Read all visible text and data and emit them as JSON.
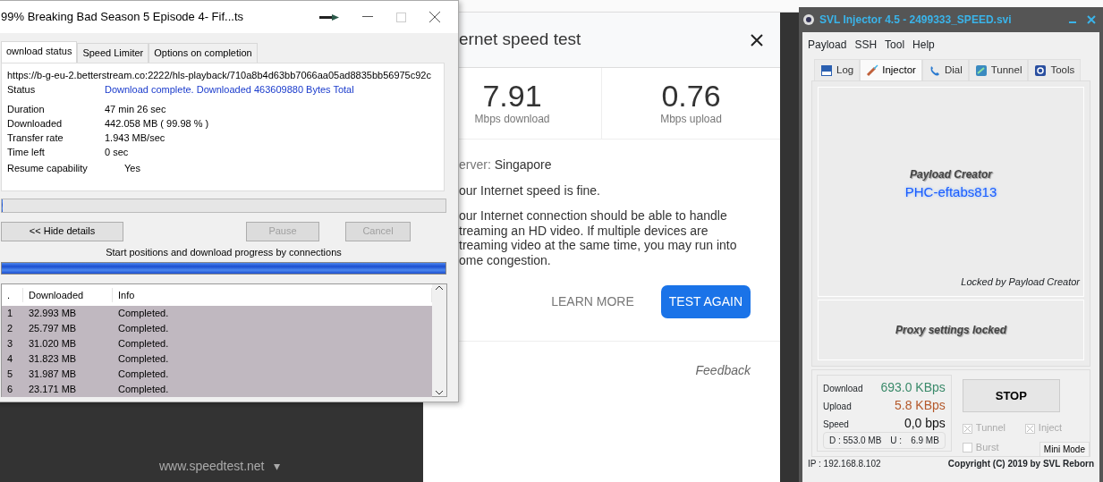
{
  "download_dialog": {
    "title": "99% Breaking Bad Season 5 Episode 4- Fif...ts",
    "tabs": [
      {
        "label": "ownload status",
        "selected": true
      },
      {
        "label": "Speed Limiter",
        "selected": false
      },
      {
        "label": "Options on completion",
        "selected": false
      }
    ],
    "url": "https://b-g-eu-2.betterstream.co:2222/hls-playback/710a8b4d63bb7066aa05ad8835bb56975c92c",
    "status": {
      "label": "Status",
      "value": "Download complete. Downloaded 463609880 Bytes Total"
    },
    "details": [
      {
        "label": "Duration",
        "value": "47 min 26 sec"
      },
      {
        "label": "Downloaded",
        "value": "442.058  MB  ( 99.98 % )"
      },
      {
        "label": "Transfer rate",
        "value": "1.943  MB/sec"
      },
      {
        "label": "Time left",
        "value": "0 sec"
      }
    ],
    "resume": {
      "label": "Resume capability",
      "value": "Yes"
    },
    "progress": {
      "level": 0
    },
    "buttons": [
      {
        "label": "<< Hide details",
        "disabled": false
      },
      {
        "label": "Pause",
        "disabled": true
      },
      {
        "label": "Cancel",
        "disabled": true
      }
    ],
    "connections_caption": "Start positions and download progress by connections",
    "connections_progress": {
      "level": 1
    },
    "table": {
      "columns": [
        ".",
        "Downloaded",
        "Info"
      ],
      "rows": [
        {
          "column_1": "1",
          "downloaded": "32.993  MB",
          "info": "Completed."
        },
        {
          "column_1": "2",
          "downloaded": "25.797  MB",
          "info": "Completed."
        },
        {
          "column_1": "3",
          "downloaded": "31.020  MB",
          "info": "Completed."
        },
        {
          "column_1": "4",
          "downloaded": "31.823  MB",
          "info": "Completed."
        },
        {
          "column_1": "5",
          "downloaded": "31.987  MB",
          "info": "Completed."
        },
        {
          "column_1": "6",
          "downloaded": "23.171  MB",
          "info": "Completed."
        }
      ]
    }
  },
  "background_page": {
    "footer_link": "www.speedtest.net",
    "footer_caret": "▾"
  },
  "speed_test": {
    "title": "ernet speed test",
    "results": [
      {
        "value": "7.91",
        "unit": "Mbps download"
      },
      {
        "value": "0.76",
        "unit": "Mbps upload"
      }
    ],
    "server_label": "erver:",
    "server_value": "Singapore",
    "verdict": "our Internet speed is fine.",
    "description": "our Internet connection should be able to handle treaming an HD video. If multiple devices are treaming video at the same time, you may run into ome congestion.",
    "learn_more": "LEARN MORE",
    "test_again": "TEST AGAIN",
    "feedback": "Feedback"
  },
  "injector": {
    "title": "SVL Injector 4.5 - 2499333_SPEED.svi",
    "menu": [
      "Payload",
      "SSH",
      "Tool",
      "Help"
    ],
    "tabs": [
      {
        "label": "Log",
        "selected": false,
        "kind": "log"
      },
      {
        "label": "Injector",
        "selected": true,
        "kind": "injector"
      },
      {
        "label": "Dial",
        "selected": false,
        "kind": "dial"
      },
      {
        "label": "Tunnel",
        "selected": false,
        "kind": "tunnel"
      },
      {
        "label": "Tools",
        "selected": false,
        "kind": "tools"
      }
    ],
    "payload_caption": "Payload Creator",
    "payload_name": "PHC-eftabs813",
    "locked_by": "Locked by Payload Creator",
    "proxy_locked": "Proxy settings locked",
    "stats": [
      {
        "label": "Download",
        "value": "693.0 KBps",
        "color": "#3a8a6a"
      },
      {
        "label": "Upload",
        "value": "5.8 KBps",
        "color": "#b4582a"
      },
      {
        "label": "Speed",
        "value": "0,0 bps",
        "color": "#111111"
      }
    ],
    "totals": {
      "download": "D :  553.0 MB",
      "upload_label": "U :",
      "upload": "6.9 MB"
    },
    "stop_button": "STOP",
    "options": [
      {
        "label": "Tunnel",
        "checked": true
      },
      {
        "label": "Inject",
        "checked": true
      },
      {
        "label": "Burst",
        "checked": false
      }
    ],
    "mini_mode": "Mini Mode",
    "ip": "IP : 192.168.8.102",
    "copyright": "Copyright (C) 2019 by SVL Reborn"
  }
}
